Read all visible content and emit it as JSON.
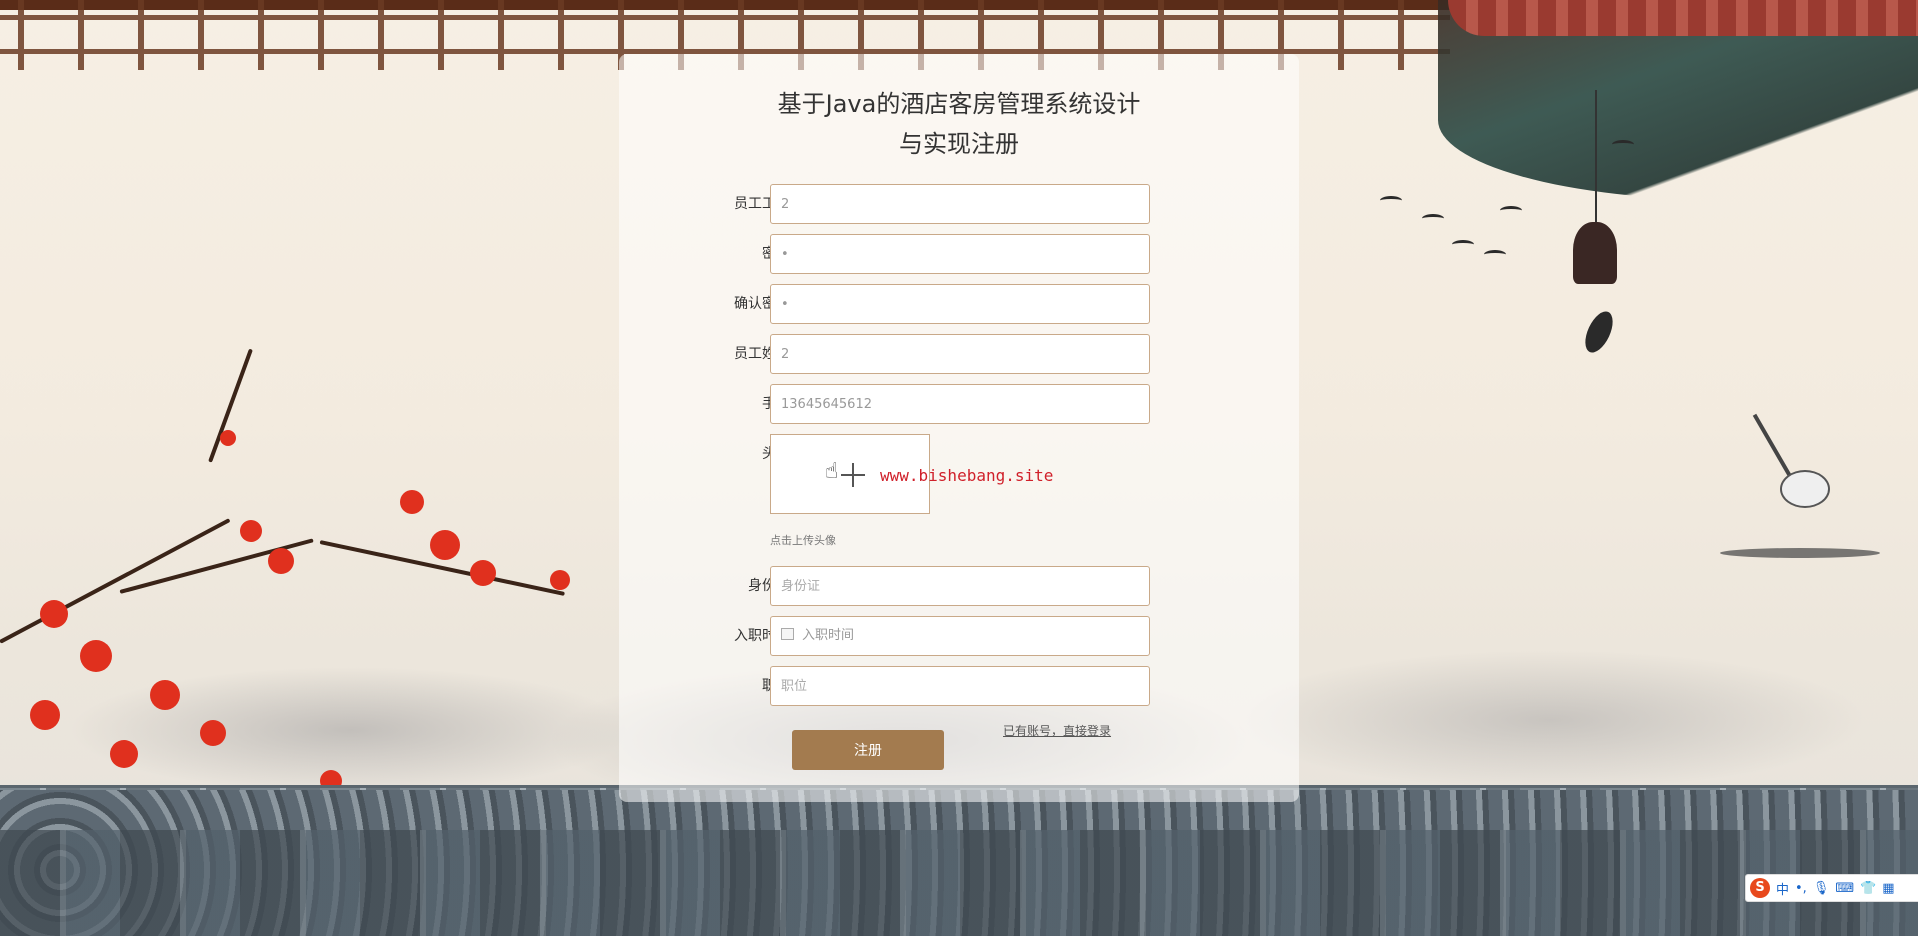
{
  "title": {
    "line1": "基于Java的酒店客房管理系统设计",
    "line2": "与实现注册"
  },
  "form": {
    "employee_no": {
      "label": "员工工号",
      "value": "2"
    },
    "password": {
      "label": "密码",
      "value": "•"
    },
    "confirm_password": {
      "label": "确认密码",
      "value": "•"
    },
    "employee_name": {
      "label": "员工姓名",
      "value": "2"
    },
    "phone": {
      "label": "手机",
      "value": "13645645612"
    },
    "avatar": {
      "label": "头像",
      "upload_tip": "点击上传头像"
    },
    "id_card": {
      "label": "身份证",
      "placeholder": "身份证"
    },
    "hire_date": {
      "label": "入职时间",
      "placeholder": "入职时间"
    },
    "position": {
      "label": "职位",
      "placeholder": "职位"
    }
  },
  "register_button": "注册",
  "login_link": "已有账号，直接登录",
  "watermark": "www.bishebang.site",
  "ime": {
    "logo": "S",
    "mode": "中",
    "punct": "•,",
    "icons": [
      "mic-icon",
      "keyboard-icon",
      "shirt-icon",
      "grid-icon"
    ]
  },
  "colors": {
    "button": "#a37b4f",
    "field_border": "#c9a989",
    "watermark": "#d0202a"
  }
}
